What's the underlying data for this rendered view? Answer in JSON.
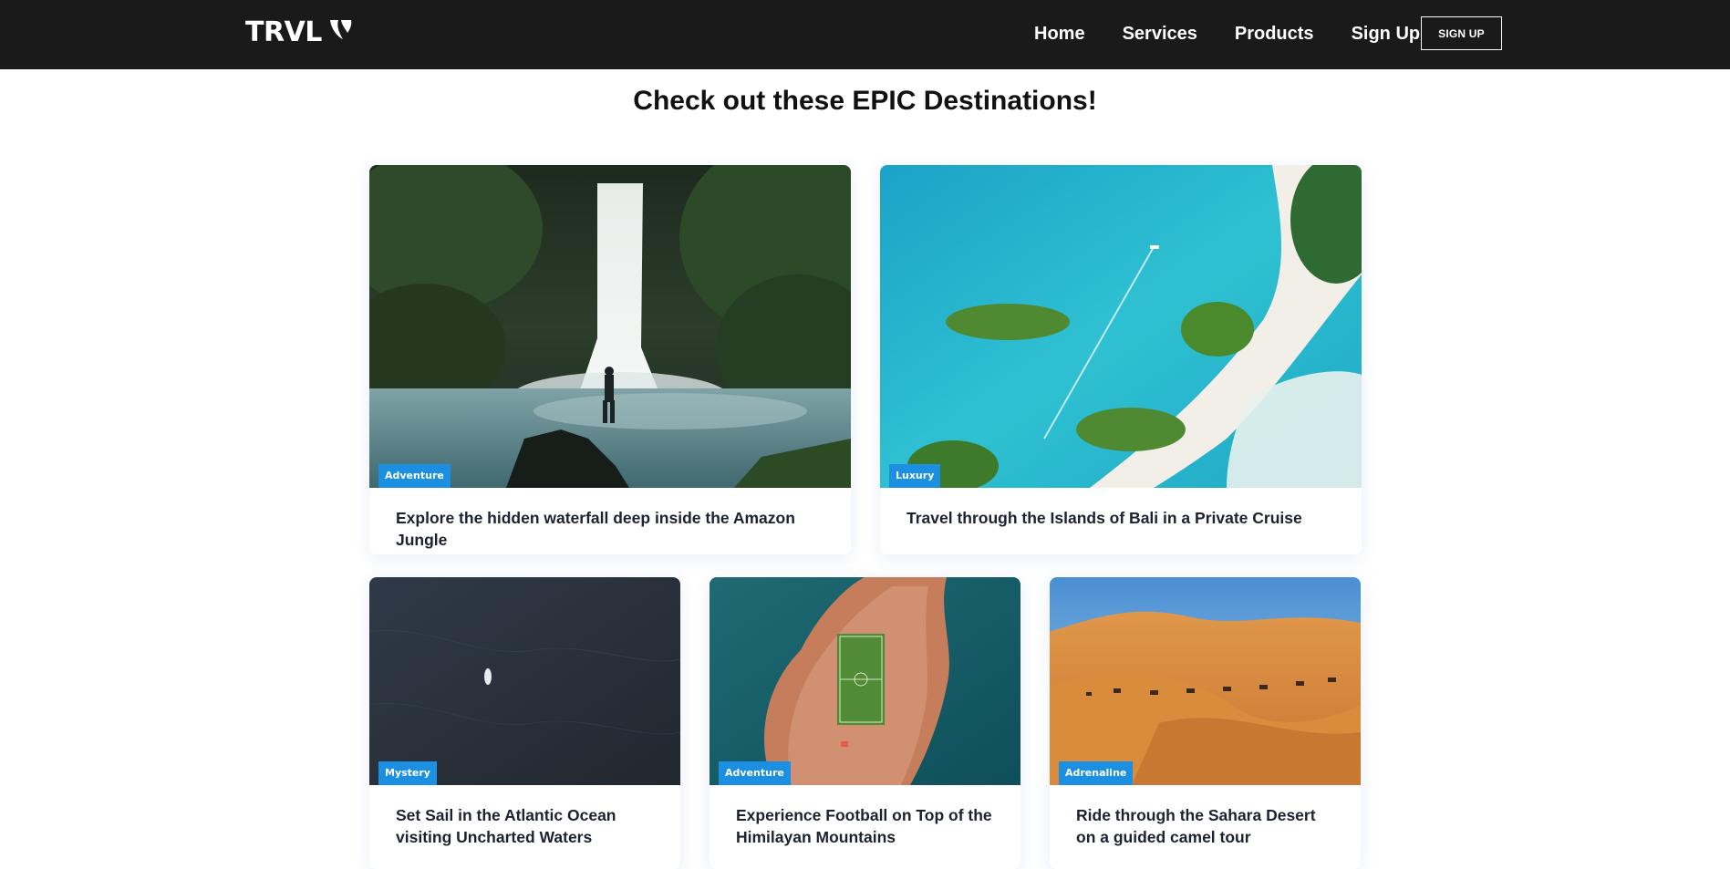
{
  "brand": {
    "name": "TRVL",
    "icon": "typo3-logo-icon"
  },
  "nav": {
    "links": [
      {
        "label": "Home"
      },
      {
        "label": "Services"
      },
      {
        "label": "Products"
      },
      {
        "label": "Sign Up"
      }
    ],
    "cta_label": "SIGN UP"
  },
  "page": {
    "title": "Check out these EPIC Destinations!"
  },
  "cards": [
    {
      "tag": "Adventure",
      "title": "Explore the hidden waterfall deep inside the Amazon Jungle",
      "image": "waterfall-photo"
    },
    {
      "tag": "Luxury",
      "title": "Travel through the Islands of Bali in a Private Cruise",
      "image": "islands-aerial-photo"
    },
    {
      "tag": "Mystery",
      "title": "Set Sail in the Atlantic Ocean visiting Uncharted Waters",
      "image": "ocean-boat-photo"
    },
    {
      "tag": "Adventure",
      "title": "Experience Football on Top of the Himilayan Mountains",
      "image": "football-field-aerial-photo"
    },
    {
      "tag": "Adrenaline",
      "title": "Ride through the Sahara Desert on a guided camel tour",
      "image": "desert-camels-photo"
    }
  ],
  "colors": {
    "navbar_bg": "#1a1a1a",
    "tag_bg": "#1b8fe2",
    "title_text": "#1c2230"
  }
}
